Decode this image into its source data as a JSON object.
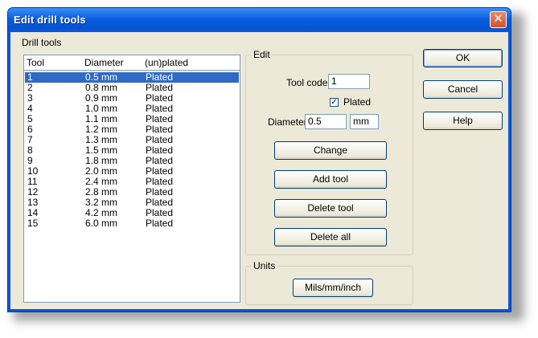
{
  "window": {
    "title": "Edit drill tools",
    "close_symbol": "✕"
  },
  "drill_tools": {
    "label": "Drill tools",
    "columns": [
      "Tool",
      "Diameter",
      "(un)plated"
    ],
    "rows": [
      [
        "1",
        "0.5 mm",
        "Plated"
      ],
      [
        "2",
        "0.8 mm",
        "Plated"
      ],
      [
        "3",
        "0.9 mm",
        "Plated"
      ],
      [
        "4",
        "1.0 mm",
        "Plated"
      ],
      [
        "5",
        "1.1 mm",
        "Plated"
      ],
      [
        "6",
        "1.2 mm",
        "Plated"
      ],
      [
        "7",
        "1.3 mm",
        "Plated"
      ],
      [
        "8",
        "1.5 mm",
        "Plated"
      ],
      [
        "9",
        "1.8 mm",
        "Plated"
      ],
      [
        "10",
        "2.0 mm",
        "Plated"
      ],
      [
        "11",
        "2.4 mm",
        "Plated"
      ],
      [
        "12",
        "2.8 mm",
        "Plated"
      ],
      [
        "13",
        "3.2 mm",
        "Plated"
      ],
      [
        "14",
        "4.2 mm",
        "Plated"
      ],
      [
        "15",
        "6.0 mm",
        "Plated"
      ]
    ],
    "selected_index": 0
  },
  "edit": {
    "group_label": "Edit",
    "tool_code_label": "Tool code",
    "tool_code_value": "1",
    "plated_label": "Plated",
    "plated_checked": true,
    "diameter_label": "Diameter",
    "diameter_value": "0.5",
    "unit_value": "mm",
    "change_label": "Change",
    "add_tool_label": "Add tool",
    "delete_tool_label": "Delete tool",
    "delete_all_label": "Delete all"
  },
  "units": {
    "group_label": "Units",
    "toggle_label": "Mils/mm/inch"
  },
  "actions": {
    "ok_label": "OK",
    "cancel_label": "Cancel",
    "help_label": "Help"
  }
}
